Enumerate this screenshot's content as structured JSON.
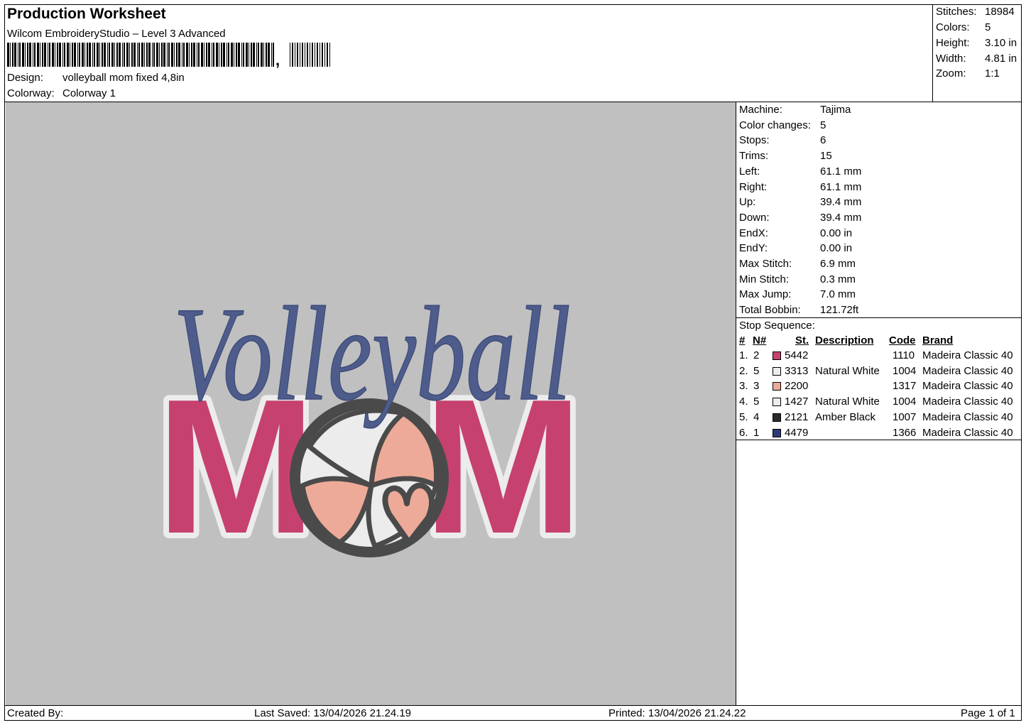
{
  "header": {
    "title": "Production Worksheet",
    "software": "Wilcom EmbroideryStudio – Level 3 Advanced",
    "barcode_suffix": ",",
    "design_label": "Design:",
    "design_value": "volleyball mom fixed 4,8in",
    "colorway_label": "Colorway:",
    "colorway_value": "Colorway 1"
  },
  "stats": {
    "stitches_label": "Stitches:",
    "stitches_value": "18984",
    "colors_label": "Colors:",
    "colors_value": "5",
    "height_label": "Height:",
    "height_value": "3.10 in",
    "width_label": "Width:",
    "width_value": "4.81 in",
    "zoom_label": "Zoom:",
    "zoom_value": "1:1"
  },
  "machine": [
    {
      "label": "Machine:",
      "value": "Tajima"
    },
    {
      "label": "Color changes:",
      "value": "5"
    },
    {
      "label": "Stops:",
      "value": "6"
    },
    {
      "label": "Trims:",
      "value": "15"
    },
    {
      "label": "Left:",
      "value": "61.1 mm"
    },
    {
      "label": "Right:",
      "value": "61.1 mm"
    },
    {
      "label": "Up:",
      "value": "39.4 mm"
    },
    {
      "label": "Down:",
      "value": "39.4 mm"
    },
    {
      "label": "EndX:",
      "value": "0.00 in"
    },
    {
      "label": "EndY:",
      "value": "0.00 in"
    },
    {
      "label": "Max Stitch:",
      "value": "6.9 mm"
    },
    {
      "label": "Min Stitch:",
      "value": "0.3 mm"
    },
    {
      "label": "Max Jump:",
      "value": "7.0 mm"
    },
    {
      "label": "Total Bobbin:",
      "value": "121.72ft"
    }
  ],
  "sequence": {
    "title": "Stop Sequence:",
    "headers": {
      "num": "#",
      "n": "N#",
      "st": "St.",
      "desc": "Description",
      "code": "Code",
      "brand": "Brand"
    },
    "rows": [
      {
        "num": "1.",
        "n": "2",
        "color": "#c6416f",
        "st": "5442",
        "desc": "",
        "code": "1110",
        "brand": "Madeira Classic 40"
      },
      {
        "num": "2.",
        "n": "5",
        "color": "#ececec",
        "st": "3313",
        "desc": "Natural White",
        "code": "1004",
        "brand": "Madeira Classic 40"
      },
      {
        "num": "3.",
        "n": "3",
        "color": "#eeaa98",
        "st": "2200",
        "desc": "",
        "code": "1317",
        "brand": "Madeira Classic 40"
      },
      {
        "num": "4.",
        "n": "5",
        "color": "#ececec",
        "st": "1427",
        "desc": "Natural White",
        "code": "1004",
        "brand": "Madeira Classic 40"
      },
      {
        "num": "5.",
        "n": "4",
        "color": "#2a2a2a",
        "st": "2121",
        "desc": "Amber Black",
        "code": "1007",
        "brand": "Madeira Classic 40"
      },
      {
        "num": "6.",
        "n": "1",
        "color": "#2e3a7a",
        "st": "4479",
        "desc": "",
        "code": "1366",
        "brand": "Madeira Classic 40"
      }
    ]
  },
  "design": {
    "script_text": "Volleyball",
    "block_text_left": "M",
    "block_text_right": "M",
    "colors": {
      "background": "#c0c0c0",
      "pink": "#c6416f",
      "white": "#ececec",
      "peach": "#eeaa98",
      "black": "#4a4a4a",
      "navy": "#4e5c8c"
    }
  },
  "footer": {
    "created_by": "Created By:",
    "last_saved": "Last Saved: 13/04/2026 21.24.19",
    "printed": "Printed: 13/04/2026 21.24.22",
    "page": "Page 1 of 1"
  }
}
